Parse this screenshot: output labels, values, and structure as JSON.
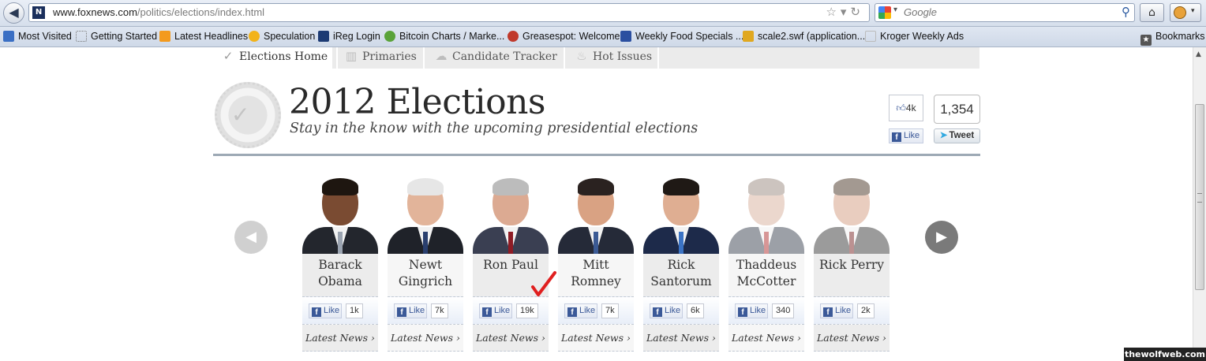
{
  "browser": {
    "url_domain": "www.foxnews.com",
    "url_path": "/politics/elections/index.html",
    "search_placeholder": "Google",
    "bookmarks": [
      {
        "label": "Most Visited",
        "icon": "most-visited-icon",
        "color": "#3a6fc4"
      },
      {
        "label": "Getting Started",
        "icon": "page-icon",
        "color": "#ffffff"
      },
      {
        "label": "Latest Headlines",
        "icon": "rss-icon",
        "color": "#f39a1e"
      },
      {
        "label": "Speculation",
        "icon": "bitcoin-icon",
        "color": "#f2b31a"
      },
      {
        "label": "iReg Login",
        "icon": "va-tax-icon",
        "color": "#1d3b74"
      },
      {
        "label": "Bitcoin Charts / Marke...",
        "icon": "chart-icon",
        "color": "#5aa33a"
      },
      {
        "label": "Greasespot: Welcome",
        "icon": "monkey-icon",
        "color": "#c0392b"
      },
      {
        "label": "Weekly Food Specials ...",
        "icon": "store-icon",
        "color": "#2b4fa0"
      },
      {
        "label": "scale2.swf (application...",
        "icon": "swf-icon",
        "color": "#e0a820"
      },
      {
        "label": "Kroger Weekly Ads",
        "icon": "page-icon",
        "color": "#ffffff"
      }
    ],
    "bookmarks_menu": "Bookmarks"
  },
  "nav": {
    "tabs": [
      {
        "label": "Elections Home",
        "icon": "check-icon"
      },
      {
        "label": "Primaries",
        "icon": "chart-icon"
      },
      {
        "label": "Candidate Tracker",
        "icon": "map-icon"
      },
      {
        "label": "Hot Issues",
        "icon": "flame-icon"
      }
    ]
  },
  "header": {
    "title": "2012 Elections",
    "subtitle": "Stay in the know with the upcoming presidential elections",
    "fb_count": "4k",
    "fb_like_label": "Like",
    "tweet_count": "1,354",
    "tweet_label": "Tweet"
  },
  "candidates": [
    {
      "first": "Barack",
      "last": "Obama",
      "likes": "1k",
      "skin": "#7a4b32",
      "hair": "#1e1610",
      "suit": "#23262d",
      "tie": "#9aa3b0",
      "faded": false
    },
    {
      "first": "Newt",
      "last": "Gingrich",
      "likes": "7k",
      "skin": "#e2b49a",
      "hair": "#e6e6e6",
      "suit": "#1f2229",
      "tie": "#2a3f6e",
      "faded": false
    },
    {
      "first": "Ron Paul",
      "last": "",
      "likes": "19k",
      "skin": "#dcaa92",
      "hair": "#bcbcbc",
      "suit": "#3a3f52",
      "tie": "#8e1c25",
      "faded": false
    },
    {
      "first": "Mitt Romney",
      "last": "",
      "likes": "7k",
      "skin": "#d9a283",
      "hair": "#2a2220",
      "suit": "#252a38",
      "tie": "#3b5a94",
      "faded": false
    },
    {
      "first": "Rick",
      "last": "Santorum",
      "likes": "6k",
      "skin": "#dfae92",
      "hair": "#1f1915",
      "suit": "#1d2a4a",
      "tie": "#3b73c4",
      "faded": false
    },
    {
      "first": "Thaddeus",
      "last": "McCotter",
      "likes": "340",
      "skin": "#d8b19d",
      "hair": "#9a8a80",
      "suit": "#3c4452",
      "tie": "#b03030",
      "faded": true
    },
    {
      "first": "Rick Perry",
      "last": "",
      "likes": "2k",
      "skin": "#d49c80",
      "hair": "#4a3526",
      "suit": "#3a3a3a",
      "tie": "#7a2626",
      "faded": true
    }
  ],
  "candidate_labels": {
    "like": "Like",
    "latest_news": "Latest News ›"
  },
  "watermark": "thewolfweb.com"
}
